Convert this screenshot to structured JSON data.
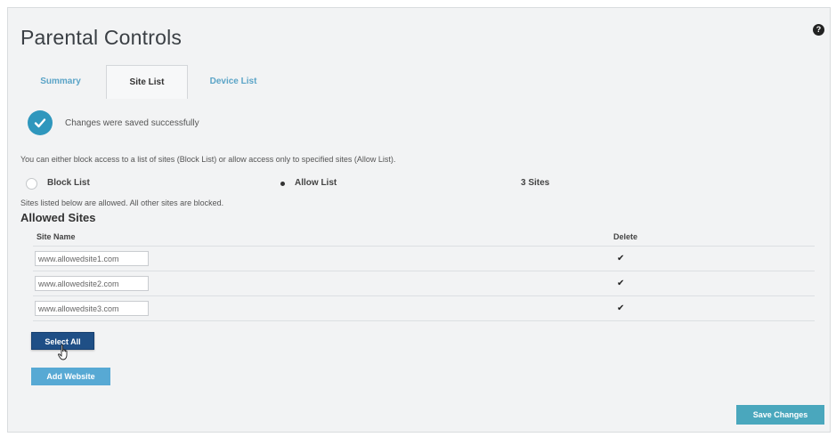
{
  "page": {
    "title": "Parental Controls",
    "help_icon": "question-icon"
  },
  "tabs": [
    {
      "label": "Summary",
      "active": false
    },
    {
      "label": "Site List",
      "active": true
    },
    {
      "label": "Device List",
      "active": false
    }
  ],
  "status": {
    "message": "Changes were saved successfully",
    "icon": "check-circle-icon",
    "color": "#2f97bd"
  },
  "intro_text": "You can either block access to a list of sites (Block List) or allow access only to specified sites (Allow List).",
  "mode": {
    "options": [
      {
        "label": "Block List",
        "selected": false
      },
      {
        "label": "Allow List",
        "selected": true
      }
    ],
    "site_count": "3 Sites"
  },
  "note": "Sites listed below are allowed. All other sites are blocked.",
  "section_title": "Allowed Sites",
  "table": {
    "headers": {
      "name": "Site Name",
      "delete": "Delete"
    },
    "rows": [
      {
        "site": "www.allowedsite1.com",
        "delete_checked": true
      },
      {
        "site": "www.allowedsite2.com",
        "delete_checked": true
      },
      {
        "site": "www.allowedsite3.com",
        "delete_checked": true
      }
    ]
  },
  "buttons": {
    "select_all": "Select All",
    "add_website": "Add Website",
    "save_changes": "Save Changes"
  },
  "colors": {
    "accent": "#2f97bd",
    "primary_button": "#1f4f86",
    "secondary_button": "#57a9d4",
    "save_button": "#4aa7bd"
  }
}
